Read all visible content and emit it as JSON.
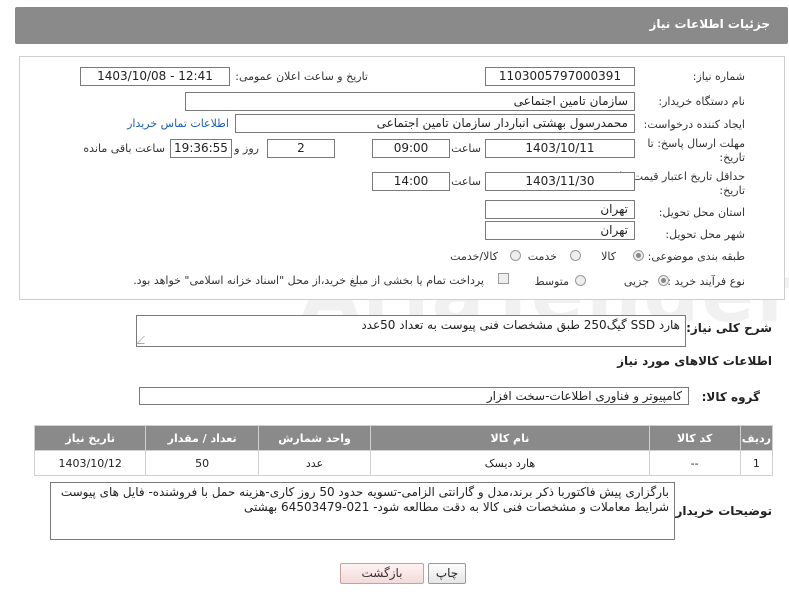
{
  "header": {
    "title": "جزئیات اطلاعات نیاز"
  },
  "form": {
    "need_number_label": "شماره نیاز:",
    "need_number": "1103005797000391",
    "announce_label": "تاریخ و ساعت اعلان عمومی:",
    "announce_value": "1403/10/08 - 12:41",
    "buyer_org_label": "نام دستگاه خریدار:",
    "buyer_org": "سازمان تامین اجتماعی",
    "requester_label": "ایجاد کننده درخواست:",
    "requester": "محمدرسول بهشتی انباردار سازمان تامین اجتماعی",
    "contact_link": "اطلاعات تماس خریدار",
    "deadline_label_1": "مهلت ارسال پاسخ: تا",
    "deadline_label_2": "تاریخ:",
    "deadline_date": "1403/10/11",
    "time_label": "ساعت",
    "deadline_time": "09:00",
    "days_value": "2",
    "days_label": "روز و",
    "remaining_time": "19:36:55",
    "remaining_label": "ساعت باقی مانده",
    "validity_label_1": "حداقل تاریخ اعتبار قیمت: تا",
    "validity_label_2": "تاریخ:",
    "validity_date": "1403/11/30",
    "validity_time_label": "ساعت",
    "validity_time": "14:00",
    "province_label": "استان محل تحویل:",
    "province": "تهران",
    "city_label": "شهر محل تحویل:",
    "city": "تهران",
    "category_label": "طبقه بندی موضوعی:",
    "category_options": [
      "کالا",
      "خدمت",
      "کالا/خدمت"
    ],
    "purchase_type_label": "نوع فرآیند خرید :",
    "purchase_options": [
      "جزیی",
      "متوسط"
    ],
    "payment_note": "پرداخت تمام یا بخشی از مبلغ خرید،از محل \"اسناد خزانه اسلامی\" خواهد بود."
  },
  "description": {
    "label": "شرح کلی نیاز:",
    "text": "هارد SSD   گیگ250 طبق مشخصات فنی پیوست به تعداد 50عدد"
  },
  "goods_section": {
    "title": "اطلاعات کالاهای مورد نیاز",
    "group_label": "گروه کالا:",
    "group_value": "کامپیوتر و فناوری اطلاعات-سخت افزار"
  },
  "table": {
    "headers": [
      "ردیف",
      "کد کالا",
      "نام کالا",
      "واحد شمارش",
      "تعداد / مقدار",
      "تاریخ نیاز"
    ],
    "rows": [
      [
        "1",
        "--",
        "هارد دیسک",
        "عدد",
        "50",
        "1403/10/12"
      ]
    ]
  },
  "buyer_notes": {
    "label": "توضیحات خریدار:",
    "text": "بارگزاری پیش فاکتوربا ذکر برند،مدل و گارانتی الزامی-تسویه حدود 50 روز کاری-هزینه حمل با فروشنده- فایل های پیوست شرایط معاملات و مشخصات فنی کالا به دقت مطالعه شود- 021-64503479 بهشتی"
  },
  "buttons": {
    "print": "چاپ",
    "back": "بازگشت"
  },
  "watermark": {
    "text": "AriaTender.neT"
  }
}
